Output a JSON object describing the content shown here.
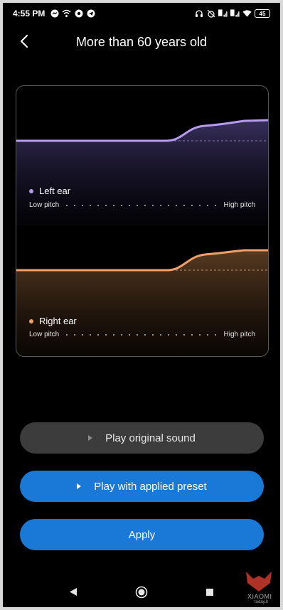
{
  "status_bar": {
    "time": "4:55 PM",
    "left_icons": [
      "messenger-icon",
      "wifi-call-icon",
      "chrome-icon",
      "telegram-icon"
    ],
    "right_icons": [
      "headphones-icon",
      "alarm-off-icon",
      "signal-icon",
      "signal-icon",
      "wifi-icon"
    ],
    "battery": "45"
  },
  "header": {
    "title": "More than 60 years old",
    "back_icon": "chevron-left-icon"
  },
  "chart": {
    "left_ear": {
      "label": "Left ear",
      "color": "#b79cf2",
      "low_label": "Low pitch",
      "high_label": "High pitch"
    },
    "right_ear": {
      "label": "Right ear",
      "color": "#f2a06a",
      "low_label": "Low pitch",
      "high_label": "High pitch"
    }
  },
  "buttons": {
    "original": "Play original sound",
    "preset": "Play with applied preset",
    "apply": "Apply"
  },
  "nav": {
    "back": "triangle-back-icon",
    "home": "circle-home-icon",
    "recents": "square-recents-icon"
  },
  "watermark": {
    "brand": "XIAOMI",
    "site": "today.it"
  }
}
